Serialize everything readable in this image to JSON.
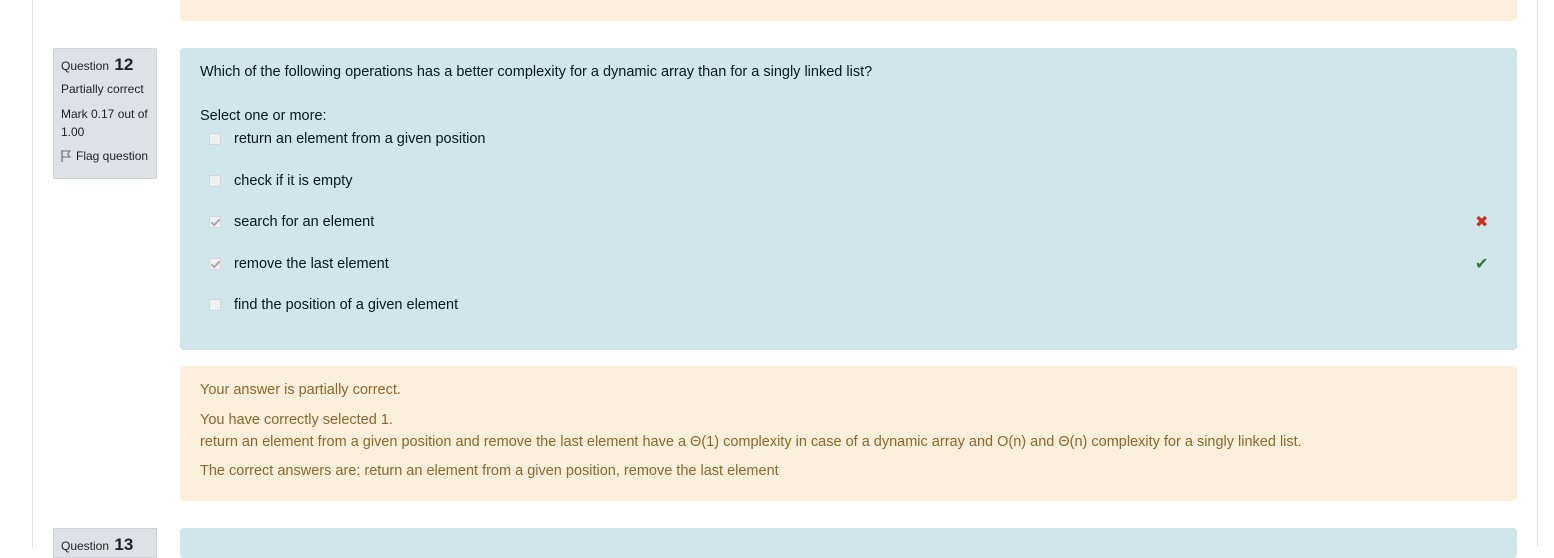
{
  "question": {
    "label": "Question",
    "number": "12",
    "state": "Partially correct",
    "grade": "Mark 0.17 out of 1.00",
    "flag_label": "Flag question",
    "text": "Which of the following operations has a better complexity for a dynamic array than for a singly linked list?",
    "prompt": "Select one or more:",
    "answers": [
      {
        "label": "return an element from a given position",
        "checked": false,
        "mark": ""
      },
      {
        "label": "check if it is empty",
        "checked": false,
        "mark": ""
      },
      {
        "label": "search for an element",
        "checked": true,
        "mark": "✖"
      },
      {
        "label": "remove the last element",
        "checked": true,
        "mark": "✔"
      },
      {
        "label": "find the position of a given element",
        "checked": false,
        "mark": ""
      }
    ]
  },
  "feedback": {
    "state": "Your answer is partially correct.",
    "selected": "You have correctly selected 1.",
    "general": "return an element from a given position and remove the last element have a Θ(1) complexity in case of a dynamic array and O(n) and Θ(n) complexity for a singly linked list.",
    "right_answer": "The correct answers are: return an element from a given position, remove the last element"
  },
  "next_question": {
    "label": "Question",
    "number": "13"
  },
  "colors": {
    "formulation_bg": "#cfe6ea",
    "feedback_bg": "#fcefdc",
    "feedback_text": "#8e662e",
    "incorrect": "#ca3120",
    "correct": "#357a32"
  }
}
